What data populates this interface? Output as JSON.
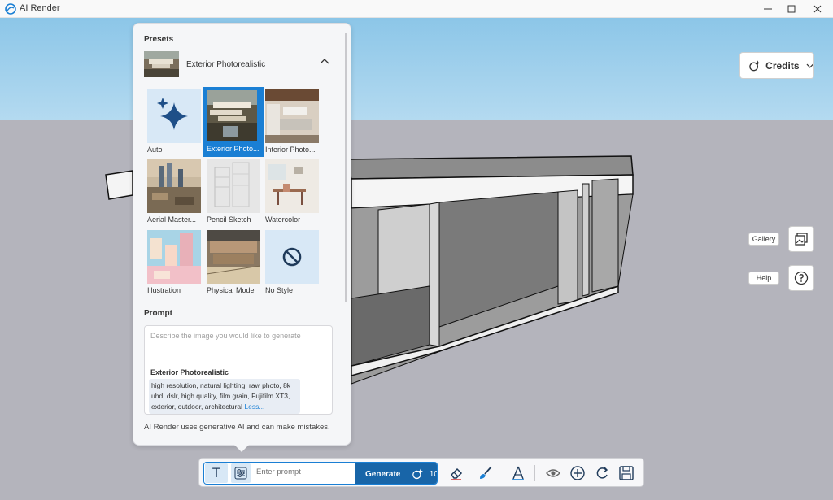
{
  "window": {
    "title": "AI Render",
    "controls": [
      "minimize-icon",
      "maximize-icon",
      "close-icon"
    ]
  },
  "credits": {
    "label": "Credits"
  },
  "side_tools": {
    "gallery_label": "Gallery",
    "help_label": "Help"
  },
  "presets_panel": {
    "title": "Presets",
    "selected": "Exterior Photorealistic",
    "items": [
      {
        "label": "Auto"
      },
      {
        "label": "Exterior Photo..."
      },
      {
        "label": "Interior Photo..."
      },
      {
        "label": "Aerial Master..."
      },
      {
        "label": "Pencil Sketch"
      },
      {
        "label": "Watercolor"
      },
      {
        "label": "Illustration"
      },
      {
        "label": "Physical Model"
      },
      {
        "label": "No Style"
      }
    ],
    "prompt_title": "Prompt",
    "prompt_placeholder": "Describe the image you would like to generate",
    "style_title": "Exterior Photorealistic",
    "style_description": "high resolution, natural lighting, raw photo, 8k uhd, dslr, high quality, film grain, Fujifilm XT3, exterior, outdoor, architectural",
    "less_link": "Less...",
    "disclaimer": "AI Render uses generative AI and can make mistakes."
  },
  "toolbar": {
    "text_mode": "T",
    "prompt_placeholder": "Enter prompt",
    "generate_label": "Generate",
    "generate_cost": "10",
    "tools": [
      "eraser-icon",
      "brush-icon",
      "perspective-icon",
      "eye-icon",
      "add-icon",
      "redo-icon",
      "save-icon"
    ]
  },
  "colors": {
    "accent": "#1a7fd4",
    "generate_bg": "#1865a8",
    "sky": "#8cc6e8",
    "ground": "#b4b4bc"
  }
}
